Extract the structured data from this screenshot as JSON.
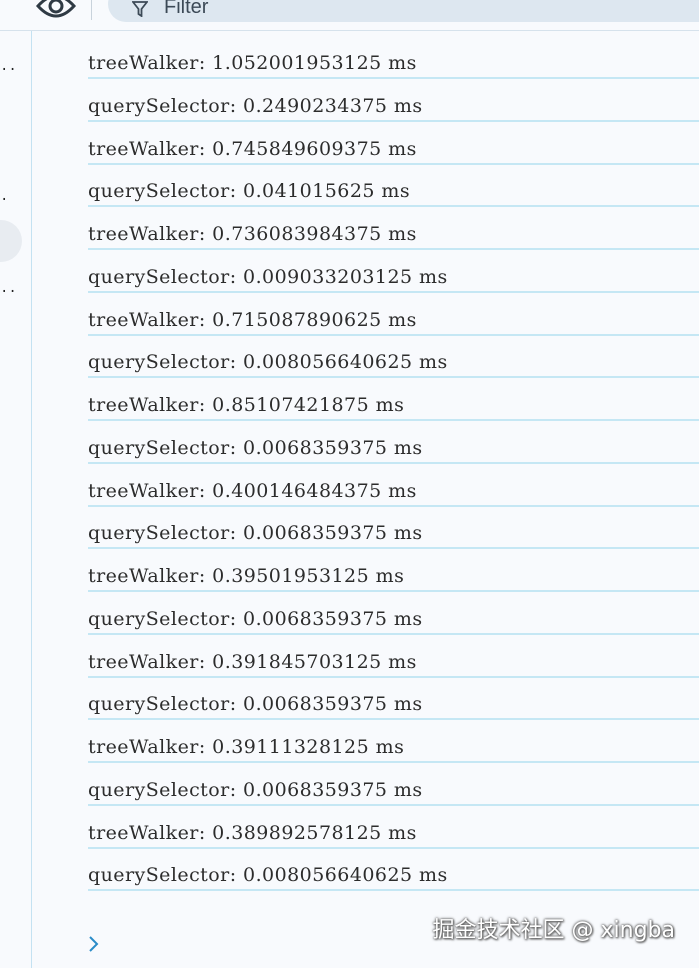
{
  "toolbar": {
    "filter_placeholder": "Filter",
    "icons": [
      "eye-icon",
      "filter-icon"
    ]
  },
  "sidebar": {
    "truncated_markers": [
      "..",
      ".",
      ".."
    ]
  },
  "console": {
    "logs": [
      "treeWalker: 1.052001953125 ms",
      "querySelector: 0.2490234375 ms",
      "treeWalker: 0.745849609375 ms",
      "querySelector: 0.041015625 ms",
      "treeWalker: 0.736083984375 ms",
      "querySelector: 0.009033203125 ms",
      "treeWalker: 0.715087890625 ms",
      "querySelector: 0.008056640625 ms",
      "treeWalker: 0.85107421875 ms",
      "querySelector: 0.0068359375 ms",
      "treeWalker: 0.400146484375 ms",
      "querySelector: 0.0068359375 ms",
      "treeWalker: 0.39501953125 ms",
      "querySelector: 0.0068359375 ms",
      "treeWalker: 0.391845703125 ms",
      "querySelector: 0.0068359375 ms",
      "treeWalker: 0.39111328125 ms",
      "querySelector: 0.0068359375 ms",
      "treeWalker: 0.389892578125 ms",
      "querySelector: 0.008056640625 ms"
    ],
    "prompt_icon": "chevron-right-icon"
  },
  "watermark": "掘金技术社区 @ xingba",
  "colors": {
    "background": "#f8fafd",
    "row_divider": "#c5e7f4",
    "filter_bg": "#dde7f0",
    "prompt": "#2a8cc8"
  }
}
